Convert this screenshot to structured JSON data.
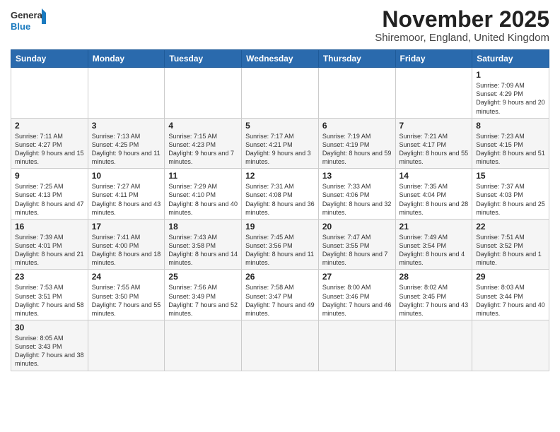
{
  "logo": {
    "line1": "General",
    "line2": "Blue"
  },
  "title": "November 2025",
  "location": "Shiremoor, England, United Kingdom",
  "weekdays": [
    "Sunday",
    "Monday",
    "Tuesday",
    "Wednesday",
    "Thursday",
    "Friday",
    "Saturday"
  ],
  "weeks": [
    [
      {
        "day": "",
        "info": ""
      },
      {
        "day": "",
        "info": ""
      },
      {
        "day": "",
        "info": ""
      },
      {
        "day": "",
        "info": ""
      },
      {
        "day": "",
        "info": ""
      },
      {
        "day": "",
        "info": ""
      },
      {
        "day": "1",
        "info": "Sunrise: 7:09 AM\nSunset: 4:29 PM\nDaylight: 9 hours and 20 minutes."
      }
    ],
    [
      {
        "day": "2",
        "info": "Sunrise: 7:11 AM\nSunset: 4:27 PM\nDaylight: 9 hours and 15 minutes."
      },
      {
        "day": "3",
        "info": "Sunrise: 7:13 AM\nSunset: 4:25 PM\nDaylight: 9 hours and 11 minutes."
      },
      {
        "day": "4",
        "info": "Sunrise: 7:15 AM\nSunset: 4:23 PM\nDaylight: 9 hours and 7 minutes."
      },
      {
        "day": "5",
        "info": "Sunrise: 7:17 AM\nSunset: 4:21 PM\nDaylight: 9 hours and 3 minutes."
      },
      {
        "day": "6",
        "info": "Sunrise: 7:19 AM\nSunset: 4:19 PM\nDaylight: 8 hours and 59 minutes."
      },
      {
        "day": "7",
        "info": "Sunrise: 7:21 AM\nSunset: 4:17 PM\nDaylight: 8 hours and 55 minutes."
      },
      {
        "day": "8",
        "info": "Sunrise: 7:23 AM\nSunset: 4:15 PM\nDaylight: 8 hours and 51 minutes."
      }
    ],
    [
      {
        "day": "9",
        "info": "Sunrise: 7:25 AM\nSunset: 4:13 PM\nDaylight: 8 hours and 47 minutes."
      },
      {
        "day": "10",
        "info": "Sunrise: 7:27 AM\nSunset: 4:11 PM\nDaylight: 8 hours and 43 minutes."
      },
      {
        "day": "11",
        "info": "Sunrise: 7:29 AM\nSunset: 4:10 PM\nDaylight: 8 hours and 40 minutes."
      },
      {
        "day": "12",
        "info": "Sunrise: 7:31 AM\nSunset: 4:08 PM\nDaylight: 8 hours and 36 minutes."
      },
      {
        "day": "13",
        "info": "Sunrise: 7:33 AM\nSunset: 4:06 PM\nDaylight: 8 hours and 32 minutes."
      },
      {
        "day": "14",
        "info": "Sunrise: 7:35 AM\nSunset: 4:04 PM\nDaylight: 8 hours and 28 minutes."
      },
      {
        "day": "15",
        "info": "Sunrise: 7:37 AM\nSunset: 4:03 PM\nDaylight: 8 hours and 25 minutes."
      }
    ],
    [
      {
        "day": "16",
        "info": "Sunrise: 7:39 AM\nSunset: 4:01 PM\nDaylight: 8 hours and 21 minutes."
      },
      {
        "day": "17",
        "info": "Sunrise: 7:41 AM\nSunset: 4:00 PM\nDaylight: 8 hours and 18 minutes."
      },
      {
        "day": "18",
        "info": "Sunrise: 7:43 AM\nSunset: 3:58 PM\nDaylight: 8 hours and 14 minutes."
      },
      {
        "day": "19",
        "info": "Sunrise: 7:45 AM\nSunset: 3:56 PM\nDaylight: 8 hours and 11 minutes."
      },
      {
        "day": "20",
        "info": "Sunrise: 7:47 AM\nSunset: 3:55 PM\nDaylight: 8 hours and 7 minutes."
      },
      {
        "day": "21",
        "info": "Sunrise: 7:49 AM\nSunset: 3:54 PM\nDaylight: 8 hours and 4 minutes."
      },
      {
        "day": "22",
        "info": "Sunrise: 7:51 AM\nSunset: 3:52 PM\nDaylight: 8 hours and 1 minute."
      }
    ],
    [
      {
        "day": "23",
        "info": "Sunrise: 7:53 AM\nSunset: 3:51 PM\nDaylight: 7 hours and 58 minutes."
      },
      {
        "day": "24",
        "info": "Sunrise: 7:55 AM\nSunset: 3:50 PM\nDaylight: 7 hours and 55 minutes."
      },
      {
        "day": "25",
        "info": "Sunrise: 7:56 AM\nSunset: 3:49 PM\nDaylight: 7 hours and 52 minutes."
      },
      {
        "day": "26",
        "info": "Sunrise: 7:58 AM\nSunset: 3:47 PM\nDaylight: 7 hours and 49 minutes."
      },
      {
        "day": "27",
        "info": "Sunrise: 8:00 AM\nSunset: 3:46 PM\nDaylight: 7 hours and 46 minutes."
      },
      {
        "day": "28",
        "info": "Sunrise: 8:02 AM\nSunset: 3:45 PM\nDaylight: 7 hours and 43 minutes."
      },
      {
        "day": "29",
        "info": "Sunrise: 8:03 AM\nSunset: 3:44 PM\nDaylight: 7 hours and 40 minutes."
      }
    ],
    [
      {
        "day": "30",
        "info": "Sunrise: 8:05 AM\nSunset: 3:43 PM\nDaylight: 7 hours and 38 minutes."
      },
      {
        "day": "",
        "info": ""
      },
      {
        "day": "",
        "info": ""
      },
      {
        "day": "",
        "info": ""
      },
      {
        "day": "",
        "info": ""
      },
      {
        "day": "",
        "info": ""
      },
      {
        "day": "",
        "info": ""
      }
    ]
  ]
}
